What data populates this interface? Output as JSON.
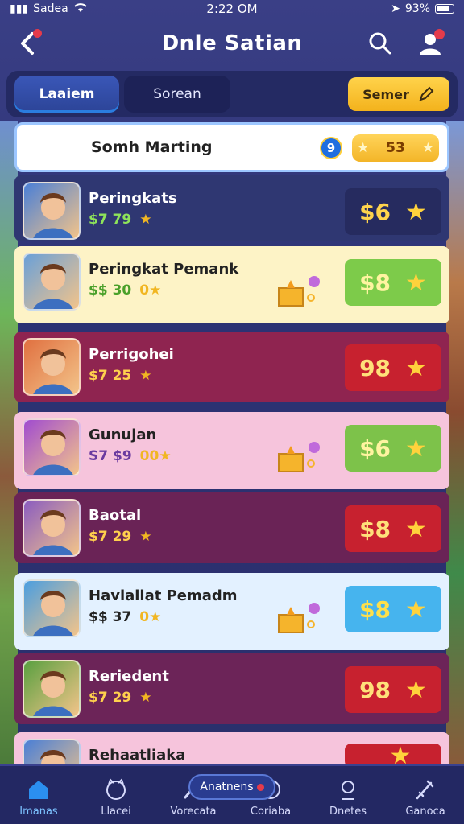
{
  "status_bar": {
    "carrier": "Sadea",
    "time": "2:22 OM",
    "battery": "93%"
  },
  "header": {
    "title": "Dnle Satian"
  },
  "tabs": {
    "active": "Laaiem",
    "inactive": "Sorean",
    "cta": "Semer"
  },
  "search_row": {
    "label": "Somh Marting",
    "help": "9",
    "score": "53"
  },
  "cards": [
    {
      "name": "Peringkats",
      "meta1": "$7 79",
      "meta2": "",
      "price": "$6",
      "bg": "#2f3772",
      "text_color": "#ffffff",
      "meta_color": "#8ee35a",
      "price_bg": "#262b5f",
      "price_color": "#ffd44c"
    },
    {
      "name": "Peringkat Pemank",
      "meta1": "$$ 30",
      "meta2": "0",
      "price": "$8",
      "bg": "#fdf3c6",
      "text_color": "#222222",
      "meta_color": "#4aa02a",
      "price_bg": "#7dcb4a",
      "price_color": "#fff4a0"
    },
    {
      "name": "Perrigohei",
      "meta1": "$7 25",
      "meta2": "",
      "price": "98",
      "bg": "#8f2450",
      "text_color": "#ffffff",
      "meta_color": "#ffd04d",
      "price_bg": "#c7212f",
      "price_color": "#ffe07a"
    },
    {
      "name": "Gunujan",
      "meta1": "S7 $9",
      "meta2": "00",
      "price": "$6",
      "bg": "#f6c4dc",
      "text_color": "#222222",
      "meta_color": "#6a3aa0",
      "price_bg": "#7dc24a",
      "price_color": "#fff4a0"
    },
    {
      "name": "Baotal",
      "meta1": "$7 29",
      "meta2": "",
      "price": "$8",
      "bg": "#6a2356",
      "text_color": "#ffffff",
      "meta_color": "#ffd04d",
      "price_bg": "#c7212f",
      "price_color": "#ffe07a"
    },
    {
      "name": "Havlallat Pemadm",
      "meta1": "$$ 37",
      "meta2": "0",
      "price": "$8",
      "bg": "#e3f1ff",
      "text_color": "#222222",
      "meta_color": "#222222",
      "price_bg": "#46b4ee",
      "price_color": "#ffe04a"
    },
    {
      "name": "Reriedent",
      "meta1": "$7 29",
      "meta2": "",
      "price": "98",
      "bg": "#6c2458",
      "text_color": "#ffffff",
      "meta_color": "#ffd04d",
      "price_bg": "#c7212f",
      "price_color": "#ffe07a"
    },
    {
      "name": "Rehaatliaka",
      "meta1": "",
      "meta2": "",
      "price": "",
      "bg": "#f6c4dc",
      "text_color": "#222222",
      "meta_color": "#222222",
      "price_bg": "#c7212f",
      "price_color": "#ffe07a"
    }
  ],
  "bottom_nav": {
    "items": [
      "Imanas",
      "Llacei",
      "Vorecata",
      "Coriaba",
      "Dnetes",
      "Ganoca"
    ],
    "center_pill": "Anatnens"
  }
}
